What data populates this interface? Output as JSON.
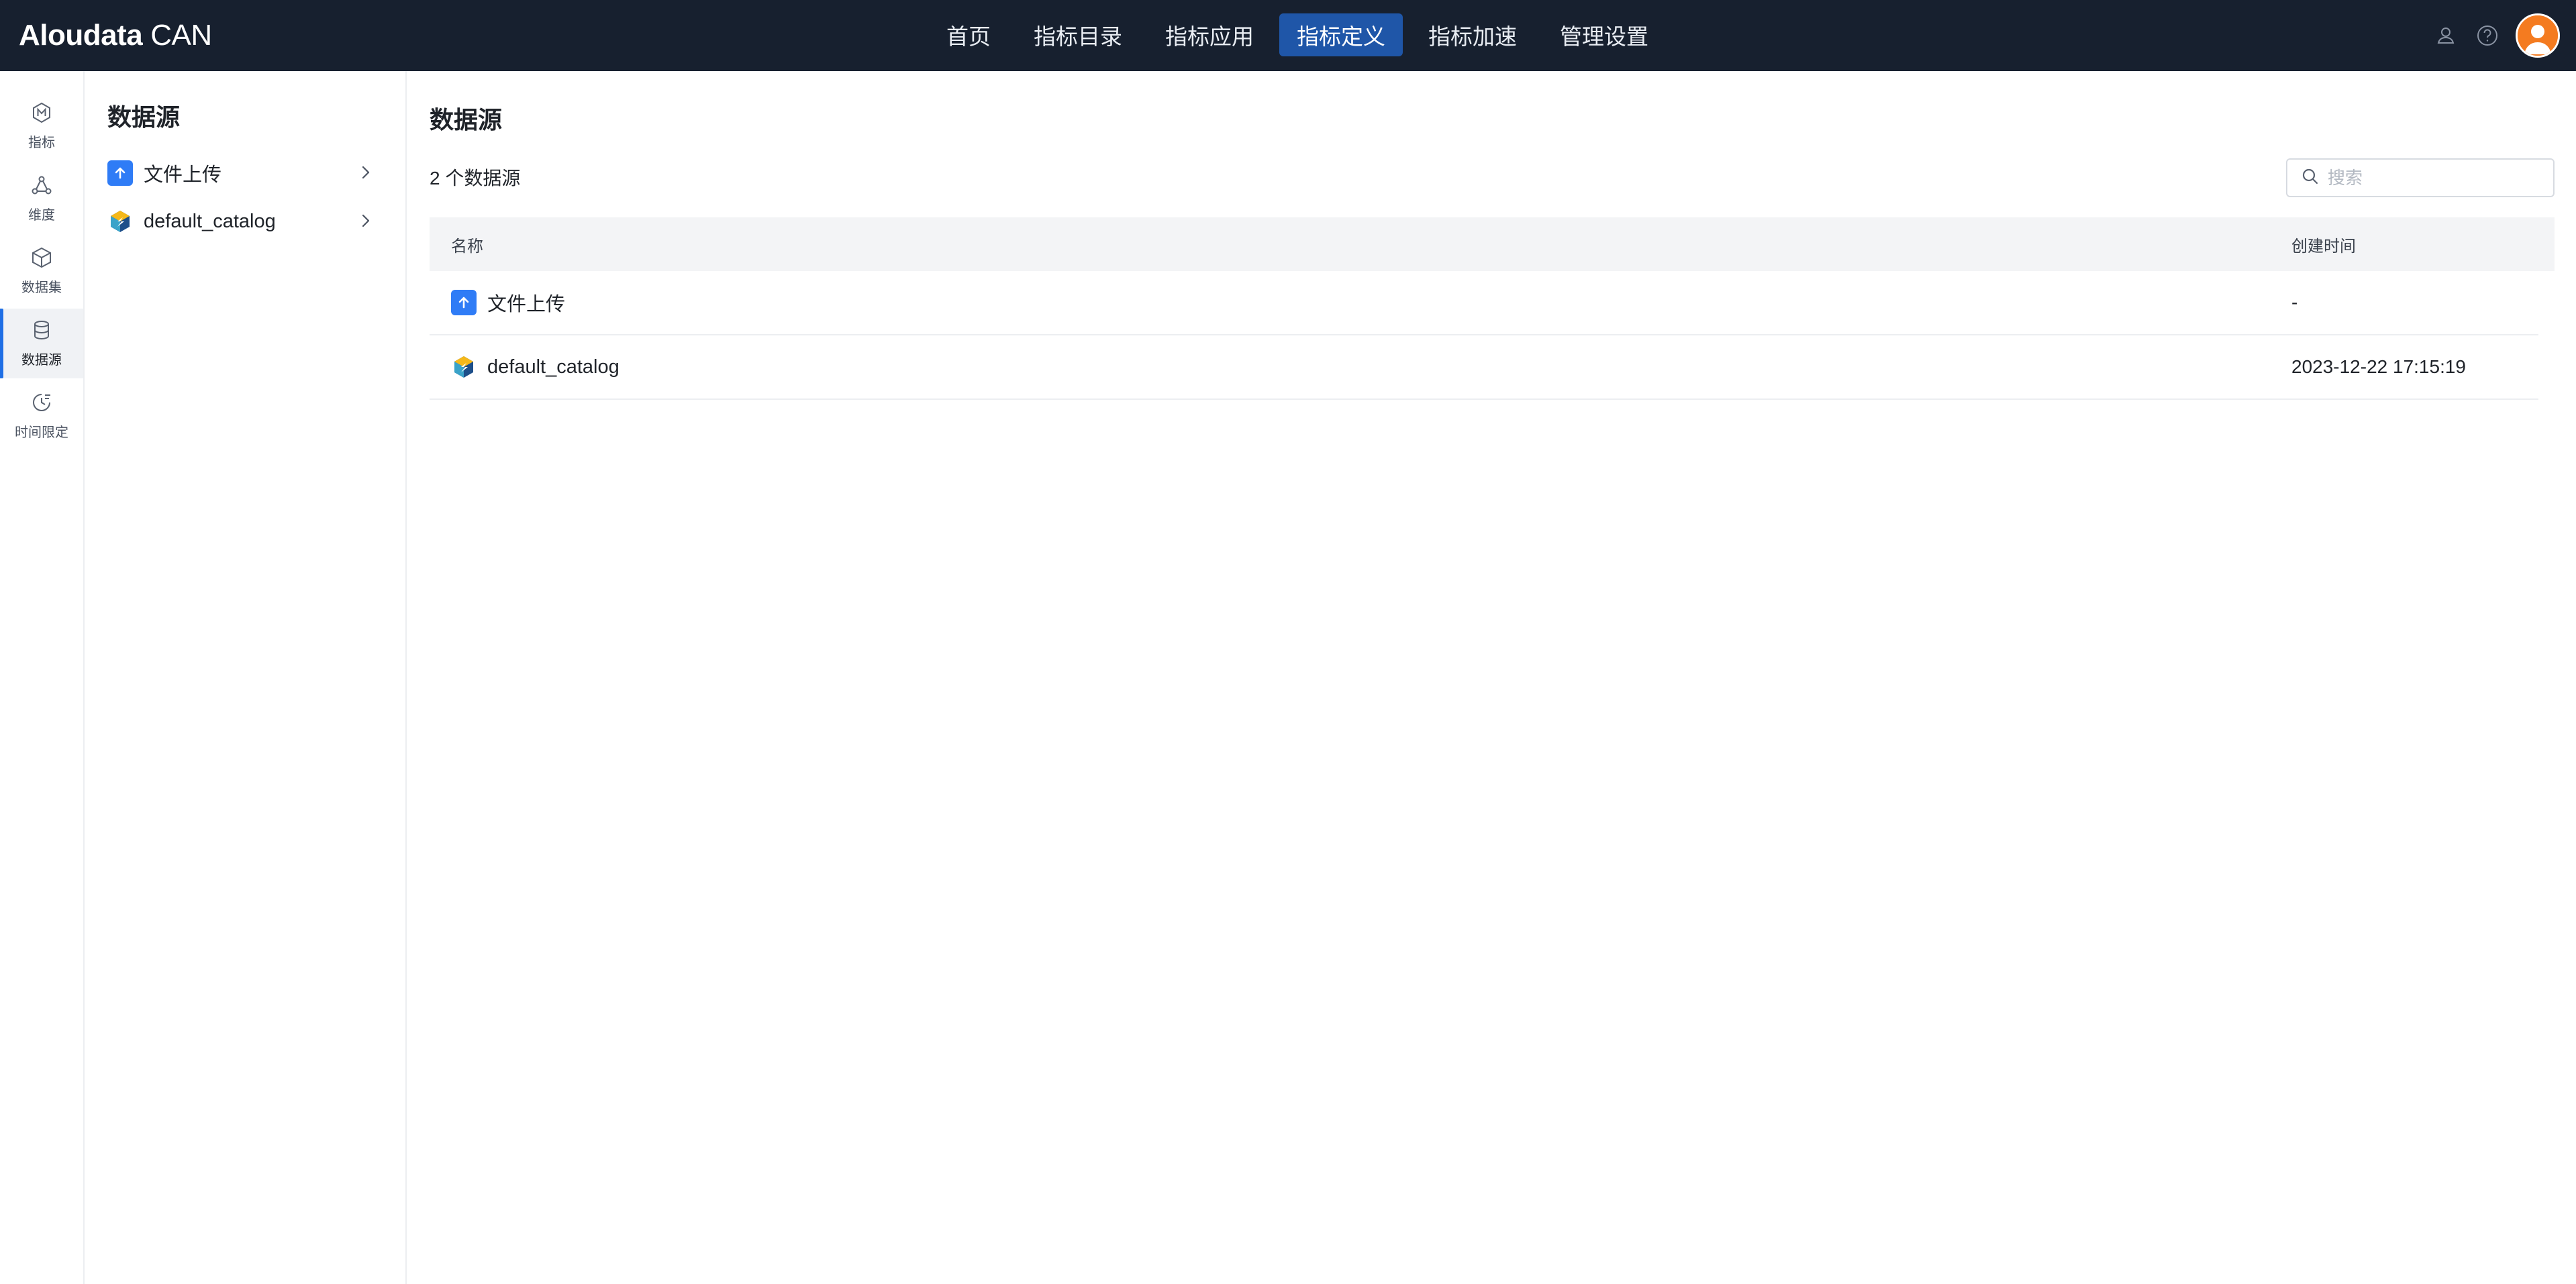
{
  "app": {
    "brand": "Aloudata",
    "suffix": "CAN"
  },
  "nav": [
    {
      "label": "首页",
      "active": false
    },
    {
      "label": "指标目录",
      "active": false
    },
    {
      "label": "指标应用",
      "active": false
    },
    {
      "label": "指标定义",
      "active": true
    },
    {
      "label": "指标加速",
      "active": false
    },
    {
      "label": "管理设置",
      "active": false
    }
  ],
  "header_icons": [
    "user-icon",
    "help-icon",
    "avatar"
  ],
  "rail": [
    {
      "label": "指标",
      "icon": "metric-icon"
    },
    {
      "label": "维度",
      "icon": "dimension-icon"
    },
    {
      "label": "数据集",
      "icon": "dataset-icon"
    },
    {
      "label": "数据源",
      "icon": "database-icon",
      "active": true
    },
    {
      "label": "时间限定",
      "icon": "time-limit-icon"
    }
  ],
  "sidebar": {
    "title": "数据源",
    "items": [
      {
        "label": "文件上传",
        "icon": "upload-icon"
      },
      {
        "label": "default_catalog",
        "icon": "catalog-icon"
      }
    ]
  },
  "main": {
    "title": "数据源",
    "count_label": "2 个数据源",
    "search_placeholder": "搜索",
    "columns": {
      "name": "名称",
      "created": "创建时间"
    },
    "rows": [
      {
        "name": "文件上传",
        "icon": "upload-icon",
        "created": "-"
      },
      {
        "name": "default_catalog",
        "icon": "catalog-icon",
        "created": "2023-12-22 17:15:19"
      }
    ]
  },
  "colors": {
    "topbar": "#17202f",
    "active_nav": "#1f56a8",
    "accent": "#1f6fe5",
    "upload_icon": "#2f7cf6",
    "avatar": "#f47b20"
  }
}
